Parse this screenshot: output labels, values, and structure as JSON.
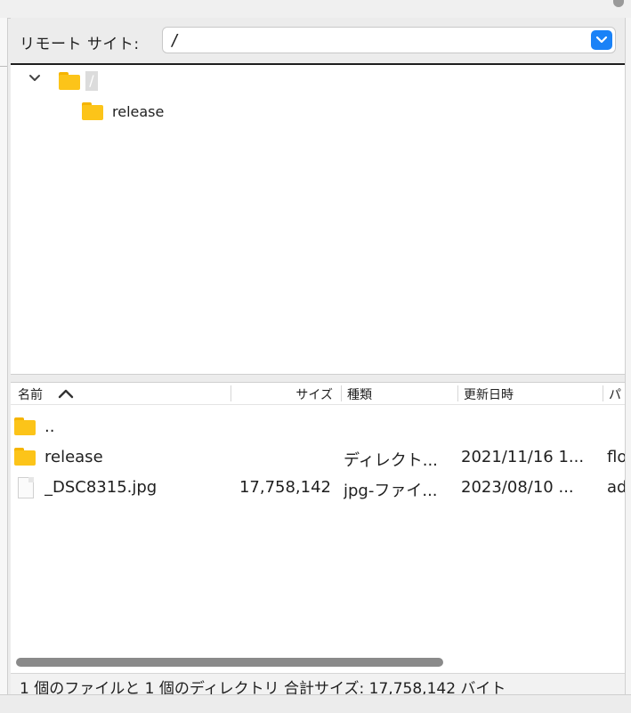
{
  "remote_site": {
    "label": "リモート サイト:",
    "path": "/"
  },
  "tree": {
    "root": "/",
    "children": [
      "release"
    ]
  },
  "file_list": {
    "columns": [
      "名前",
      "サイズ",
      "種類",
      "更新日時",
      "パ"
    ],
    "sort": "名前",
    "rows": [
      {
        "name": "..",
        "size": "",
        "type": "",
        "modified": "",
        "extra": "",
        "icon": "folder-icon"
      },
      {
        "name": "release",
        "size": "",
        "type": "ディレクト...",
        "modified": "2021/11/16 1...",
        "extra": "flo",
        "icon": "folder-icon"
      },
      {
        "name": "_DSC8315.jpg",
        "size": "17,758,142",
        "type": "jpg-ファイ...",
        "modified": "2023/08/10 ...",
        "extra": "ad",
        "icon": "file-icon"
      }
    ]
  },
  "status": {
    "text": "1 個のファイルと 1 個のディレクトリ 合計サイズ: 17,758,142 バイト"
  },
  "colors": {
    "accent": "#1a82f7",
    "folder": "#fcc419"
  }
}
